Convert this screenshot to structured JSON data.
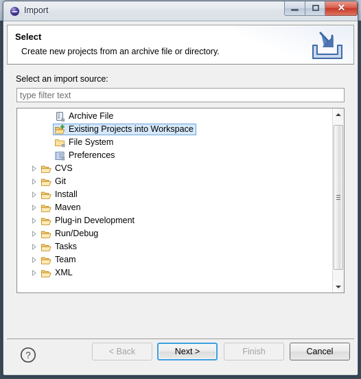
{
  "window": {
    "title": "Import",
    "icon": "eclipse-sphere-icon",
    "controls": {
      "minimize": "minimize-icon",
      "maximize": "maximize-icon",
      "close": "✕"
    }
  },
  "header": {
    "title": "Select",
    "description": "Create new projects from an archive file or directory.",
    "banner_icon": "import-arrow-into-tray-icon"
  },
  "content": {
    "source_label": "Select an import source:",
    "filter": {
      "value": "",
      "placeholder": "type filter text"
    },
    "tree": [
      {
        "label": "Archive File",
        "icon": "archive-file-icon",
        "level": "child",
        "expandable": false,
        "selected": false
      },
      {
        "label": "Existing Projects into Workspace",
        "icon": "open-folder-plus-icon",
        "level": "child",
        "expandable": false,
        "selected": true
      },
      {
        "label": "File System",
        "icon": "folder-closed-icon",
        "level": "child",
        "expandable": false,
        "selected": false
      },
      {
        "label": "Preferences",
        "icon": "preferences-list-icon",
        "level": "child",
        "expandable": false,
        "selected": false
      },
      {
        "label": "CVS",
        "icon": "folder-open-icon",
        "level": "group",
        "expandable": true,
        "selected": false
      },
      {
        "label": "Git",
        "icon": "folder-open-icon",
        "level": "group",
        "expandable": true,
        "selected": false
      },
      {
        "label": "Install",
        "icon": "folder-open-icon",
        "level": "group",
        "expandable": true,
        "selected": false
      },
      {
        "label": "Maven",
        "icon": "folder-open-icon",
        "level": "group",
        "expandable": true,
        "selected": false
      },
      {
        "label": "Plug-in Development",
        "icon": "folder-open-icon",
        "level": "group",
        "expandable": true,
        "selected": false
      },
      {
        "label": "Run/Debug",
        "icon": "folder-open-icon",
        "level": "group",
        "expandable": true,
        "selected": false
      },
      {
        "label": "Tasks",
        "icon": "folder-open-icon",
        "level": "group",
        "expandable": true,
        "selected": false
      },
      {
        "label": "Team",
        "icon": "folder-open-icon",
        "level": "group",
        "expandable": true,
        "selected": false
      },
      {
        "label": "XML",
        "icon": "folder-open-icon",
        "level": "group",
        "expandable": true,
        "selected": false
      }
    ]
  },
  "footer": {
    "help": "help-question-icon",
    "buttons": [
      {
        "label": "< Back",
        "enabled": false,
        "focused": false
      },
      {
        "label": "Next >",
        "enabled": true,
        "focused": true
      },
      {
        "label": "Finish",
        "enabled": false,
        "focused": false
      },
      {
        "label": "Cancel",
        "enabled": true,
        "focused": false
      }
    ]
  },
  "colors": {
    "accent_focus": "#3c9fe0",
    "selection_bg": "#d6e8fb",
    "selection_border": "#6aa5e0",
    "close_button": "#c63a28",
    "dialog_bg": "#f0f0f0",
    "folder_gold": "#e8b champion"
  }
}
